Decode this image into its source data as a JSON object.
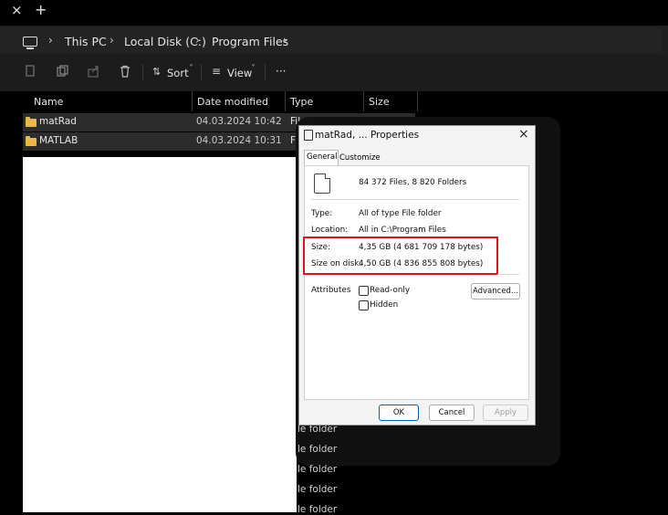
{
  "tabs": {
    "close_glyph": "×",
    "new_tab_glyph": "+"
  },
  "address_bar": {
    "chevron": "›",
    "crumbs": [
      "This PC",
      "Local Disk (C:)",
      "Program Files"
    ]
  },
  "toolbar": {
    "sort_label": "Sort",
    "view_label": "View",
    "more_label": "···",
    "dropdown_glyph": "˅"
  },
  "columns": {
    "name": "Name",
    "date_modified": "Date modified",
    "type": "Type",
    "size": "Size"
  },
  "rows": [
    {
      "name": "matRad",
      "date": "04.03.2024 10:42",
      "type": "File folder"
    },
    {
      "name": "MATLAB",
      "date": "04.03.2024 10:31",
      "type": "Fi"
    }
  ],
  "partial_type_labels": [
    "le folder",
    "le folder",
    "le folder",
    "le folder",
    "le folder"
  ],
  "dialog": {
    "title": "matRad, ... Properties",
    "close_glyph": "×",
    "tabs": [
      "General",
      "Customize"
    ],
    "summary": "84 372 Files, 8 820 Folders",
    "type_label": "Type:",
    "type_value": "All of type File folder",
    "location_label": "Location:",
    "location_value": "All in C:\\Program Files",
    "size_label": "Size:",
    "size_value": "4,35 GB (4 681 709 178 bytes)",
    "size_on_disk_label": "Size on disk:",
    "size_on_disk_value": "4,50 GB (4 836 855 808 bytes)",
    "attributes_label": "Attributes",
    "readonly_label": "Read-only",
    "hidden_label": "Hidden",
    "advanced_button": "Advanced...",
    "ok_button": "OK",
    "cancel_button": "Cancel",
    "apply_button": "Apply"
  },
  "colors": {
    "folder": "#e8b84a",
    "highlight": "#e01020",
    "ok_border": "#005fb8"
  }
}
